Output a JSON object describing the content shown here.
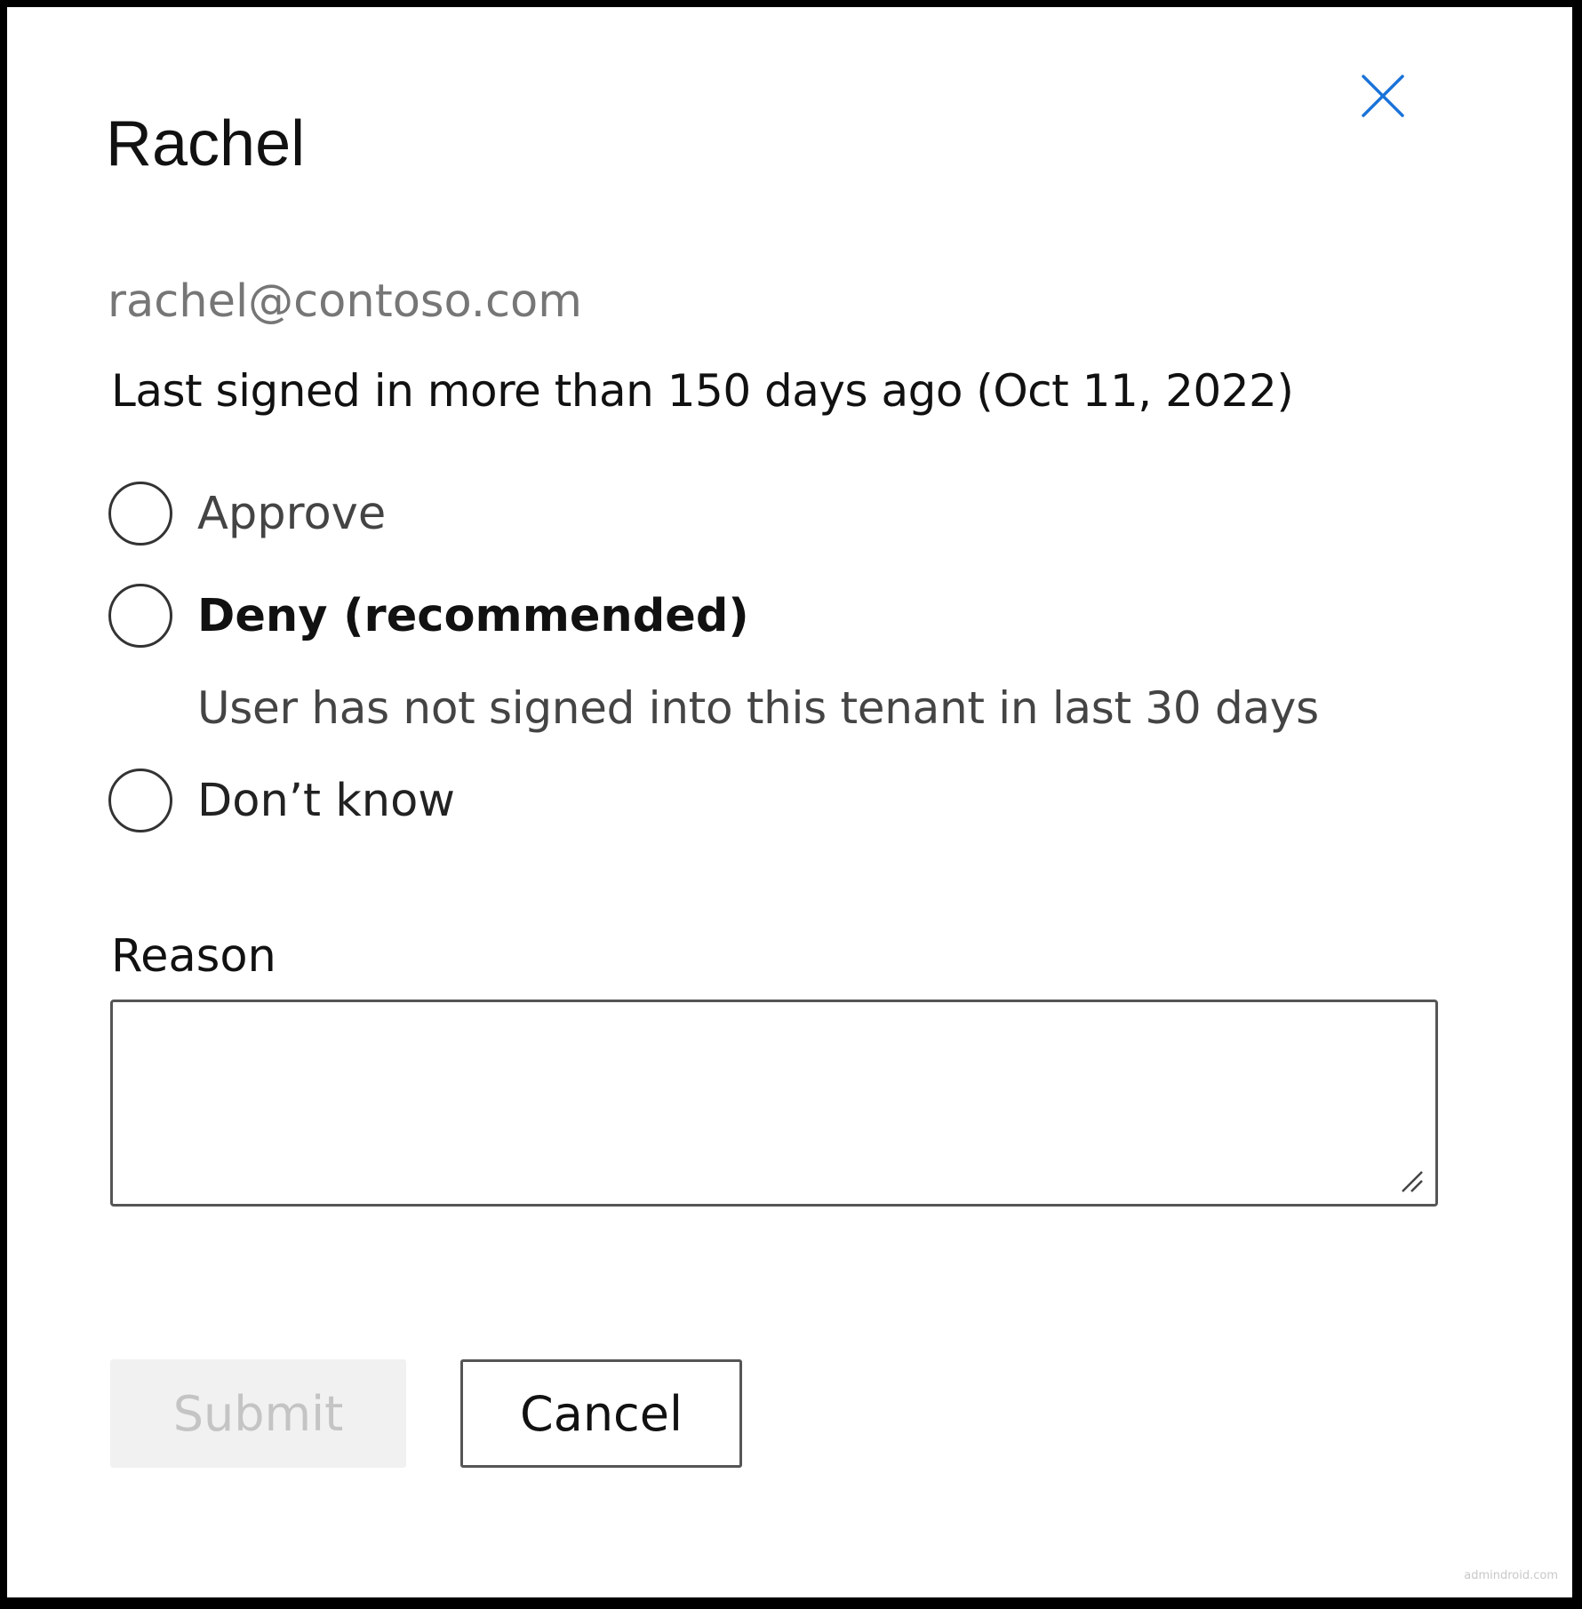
{
  "dialog": {
    "title": "Rachel",
    "email": "rachel@contoso.com",
    "last_signed_in": "Last signed in more than 150 days ago (Oct 11, 2022)",
    "close_icon": "close-icon",
    "accent_color": "#1a73d9"
  },
  "options": {
    "approve": {
      "label": "Approve",
      "selected": false
    },
    "deny": {
      "label": "Deny (recommended)",
      "selected": false,
      "hint": "User has not signed into this tenant in last 30 days"
    },
    "dont_know": {
      "label": "Don’t know",
      "selected": false
    }
  },
  "reason": {
    "label": "Reason",
    "value": ""
  },
  "buttons": {
    "submit_label": "Submit",
    "submit_disabled": true,
    "cancel_label": "Cancel"
  },
  "watermark": "admindroid.com"
}
